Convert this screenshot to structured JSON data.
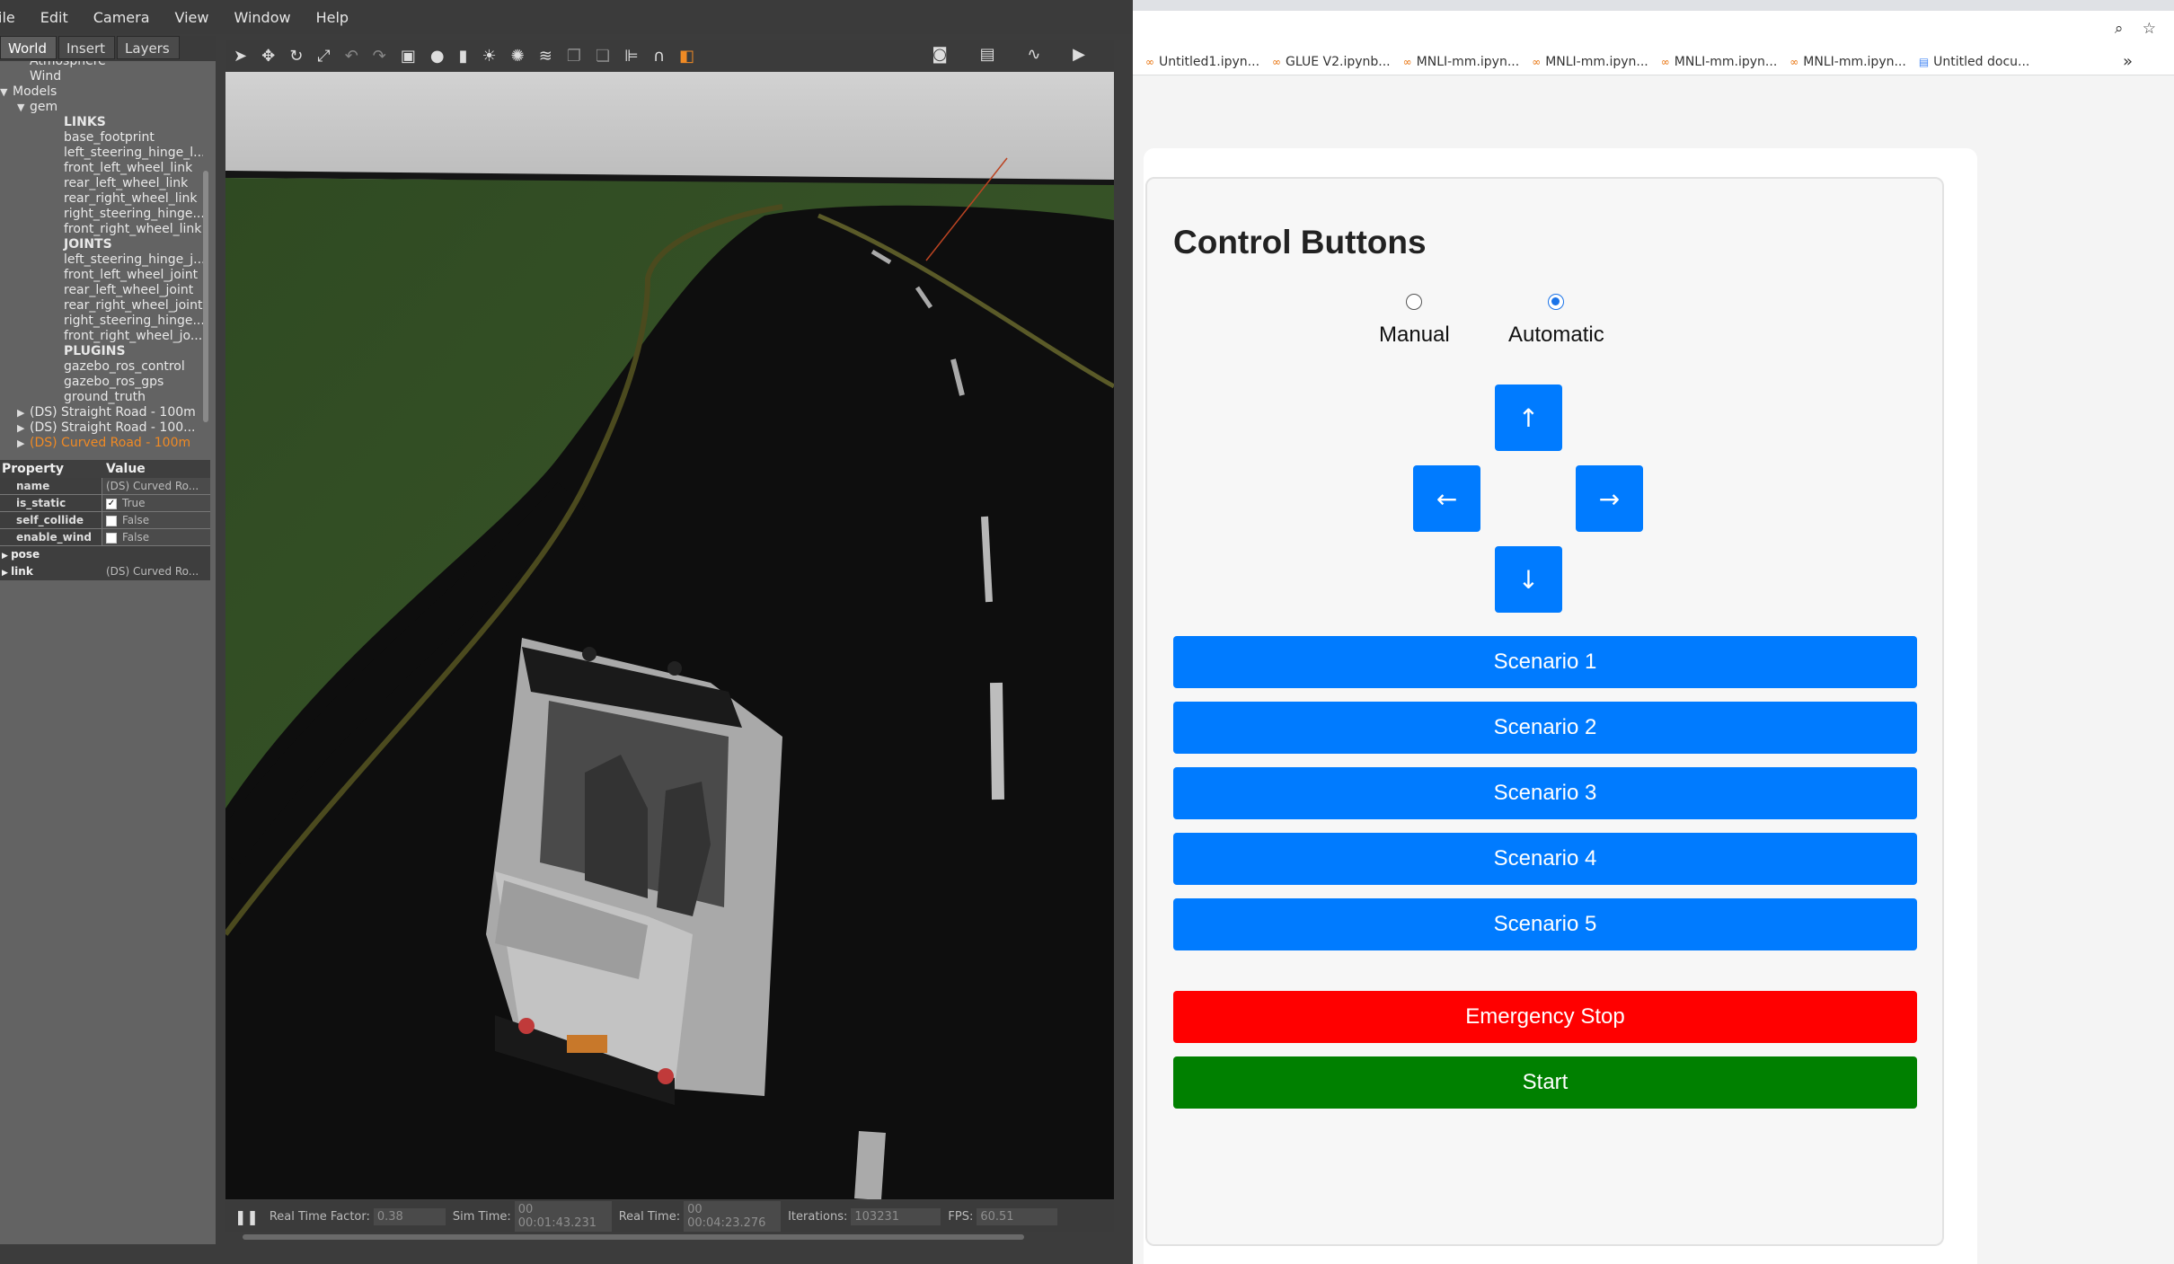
{
  "gazebo": {
    "menu": [
      "ile",
      "Edit",
      "Camera",
      "View",
      "Window",
      "Help"
    ],
    "tabs": [
      "World",
      "Insert",
      "Layers"
    ],
    "tree": [
      {
        "text": "Atmosphere",
        "level": 1,
        "kind": "item"
      },
      {
        "text": "Wind",
        "level": 1,
        "kind": "item"
      },
      {
        "text": "Models",
        "level": 0,
        "kind": "open"
      },
      {
        "text": "gem",
        "level": 1,
        "kind": "open"
      },
      {
        "text": "LINKS",
        "level": 3,
        "kind": "section"
      },
      {
        "text": "base_footprint",
        "level": 3,
        "kind": "item"
      },
      {
        "text": "left_steering_hinge_l...",
        "level": 3,
        "kind": "item"
      },
      {
        "text": "front_left_wheel_link",
        "level": 3,
        "kind": "item"
      },
      {
        "text": "rear_left_wheel_link",
        "level": 3,
        "kind": "item"
      },
      {
        "text": "rear_right_wheel_link",
        "level": 3,
        "kind": "item"
      },
      {
        "text": "right_steering_hinge...",
        "level": 3,
        "kind": "item"
      },
      {
        "text": "front_right_wheel_link",
        "level": 3,
        "kind": "item"
      },
      {
        "text": "JOINTS",
        "level": 3,
        "kind": "section"
      },
      {
        "text": "left_steering_hinge_j...",
        "level": 3,
        "kind": "item"
      },
      {
        "text": "front_left_wheel_joint",
        "level": 3,
        "kind": "item"
      },
      {
        "text": "rear_left_wheel_joint",
        "level": 3,
        "kind": "item"
      },
      {
        "text": "rear_right_wheel_joint",
        "level": 3,
        "kind": "item"
      },
      {
        "text": "right_steering_hinge...",
        "level": 3,
        "kind": "item"
      },
      {
        "text": "front_right_wheel_jo...",
        "level": 3,
        "kind": "item"
      },
      {
        "text": "PLUGINS",
        "level": 3,
        "kind": "section"
      },
      {
        "text": "gazebo_ros_control",
        "level": 3,
        "kind": "item"
      },
      {
        "text": "gazebo_ros_gps",
        "level": 3,
        "kind": "item"
      },
      {
        "text": "ground_truth",
        "level": 3,
        "kind": "item"
      },
      {
        "text": "(DS) Straight Road - 100m",
        "level": 1,
        "kind": "closed"
      },
      {
        "text": "(DS) Straight Road - 100...",
        "level": 1,
        "kind": "closed"
      },
      {
        "text": "(DS) Curved Road - 100m",
        "level": 1,
        "kind": "selected"
      }
    ],
    "props": {
      "header_property": "Property",
      "header_value": "Value",
      "rows": [
        {
          "key": "name",
          "value": "(DS) Curved Ro...",
          "check": ""
        },
        {
          "key": "is_static",
          "value": "True",
          "check": "checked"
        },
        {
          "key": "self_collide",
          "value": "False",
          "check": "unchecked"
        },
        {
          "key": "enable_wind",
          "value": "False",
          "check": "unchecked"
        }
      ],
      "groups": [
        {
          "key": "pose",
          "value": ""
        },
        {
          "key": "link",
          "value": "(DS) Curved Ro..."
        }
      ]
    },
    "status": {
      "real_time_factor_label": "Real Time Factor:",
      "real_time_factor": "0.38",
      "sim_time_label": "Sim Time:",
      "sim_time": "00 00:01:43.231",
      "real_time_label": "Real Time:",
      "real_time": "00 00:04:23.276",
      "iterations_label": "Iterations:",
      "iterations": "103231",
      "fps_label": "FPS:",
      "fps": "60.51"
    }
  },
  "browser": {
    "bookmarks": [
      {
        "label": "Untitled1.ipyn...",
        "icon": "colab-icon"
      },
      {
        "label": "GLUE V2.ipynb...",
        "icon": "colab-icon"
      },
      {
        "label": "MNLI-mm.ipyn...",
        "icon": "colab-icon"
      },
      {
        "label": "MNLI-mm.ipyn...",
        "icon": "colab-icon"
      },
      {
        "label": "MNLI-mm.ipyn...",
        "icon": "colab-icon"
      },
      {
        "label": "MNLI-mm.ipyn...",
        "icon": "colab-icon"
      },
      {
        "label": "Untitled docu...",
        "icon": "doc-icon"
      }
    ],
    "more": "»"
  },
  "panel": {
    "title": "Control Buttons",
    "mode": {
      "manual_label": "Manual",
      "automatic_label": "Automatic",
      "selected": "Automatic"
    },
    "arrows": {
      "up": "↑",
      "left": "←",
      "right": "→",
      "down": "↓"
    },
    "scenarios": [
      "Scenario 1",
      "Scenario 2",
      "Scenario 3",
      "Scenario 4",
      "Scenario 5"
    ],
    "emergency_label": "Emergency Stop",
    "start_label": "Start",
    "colors": {
      "primary": "#007bff",
      "danger": "#ff0000",
      "success": "#008000"
    }
  }
}
